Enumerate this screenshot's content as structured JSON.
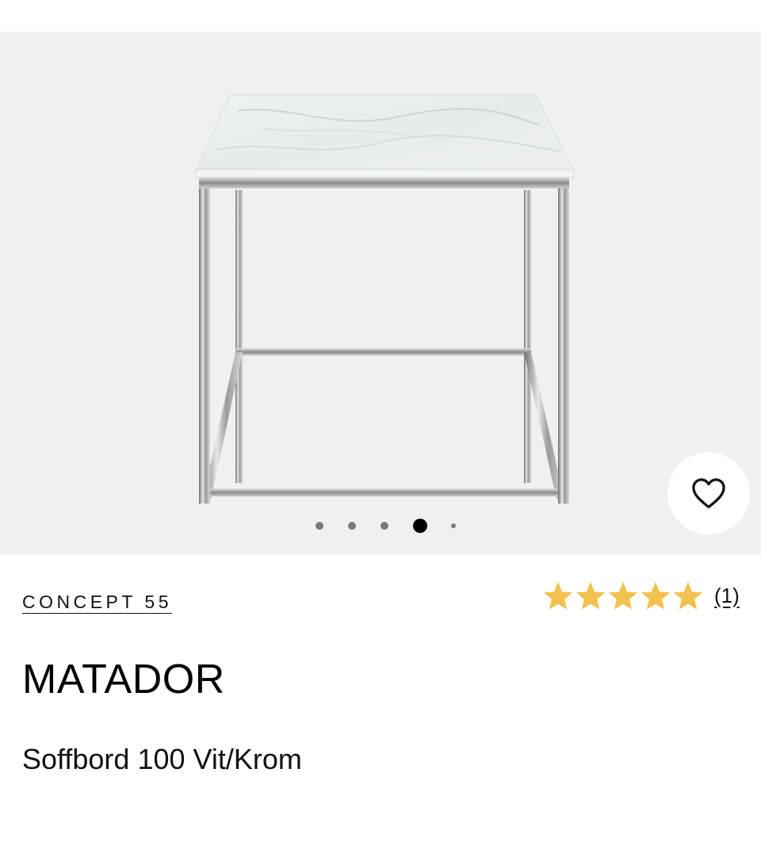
{
  "gallery": {
    "image_alt": "MATADOR Soffbord 100 Vit/Krom",
    "slide_count": 5,
    "active_slide": 4
  },
  "actions": {
    "wishlist_icon": "heart-outline-icon"
  },
  "product": {
    "brand": "CONCEPT 55",
    "name": "MATADOR",
    "description": "Soffbord 100 Vit/Krom",
    "rating": {
      "stars": 5,
      "max": 5,
      "count_label": "(1)"
    }
  },
  "colors": {
    "background": "#ffffff",
    "gallery_background": "#f0f0f0",
    "star": "#f2c14e",
    "text": "#111111"
  }
}
